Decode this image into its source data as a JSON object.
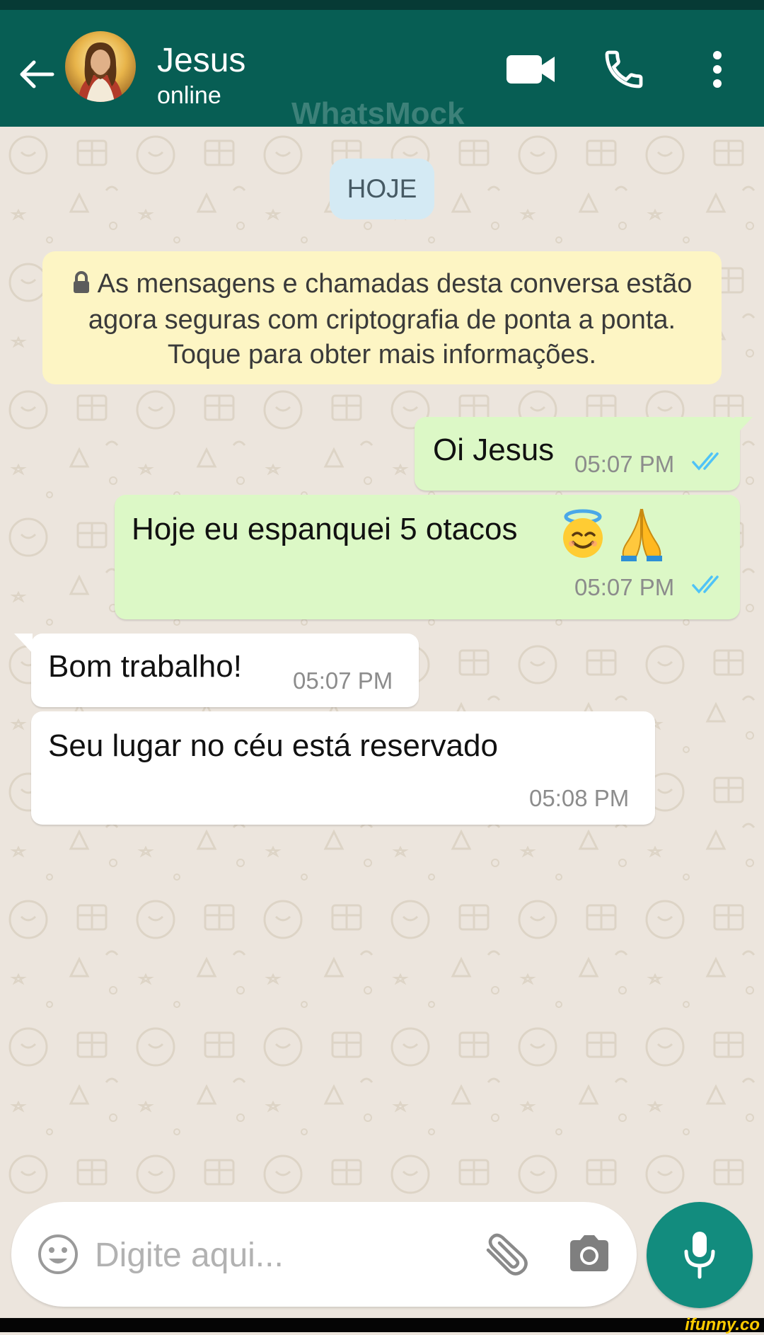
{
  "header": {
    "contact_name": "Jesus",
    "contact_status": "online",
    "watermark": "WhatsMock",
    "icons": [
      "back-arrow-icon",
      "video-call-icon",
      "phone-icon",
      "more-vertical-icon"
    ]
  },
  "chat": {
    "date_label": "HOJE",
    "encryption_notice": "As mensagens e chamadas desta conversa estão agora seguras com criptografia de ponta a ponta. Toque para obter mais informações.",
    "messages": [
      {
        "direction": "outgoing",
        "text": "Oi Jesus",
        "time": "05:07 PM",
        "status": "read"
      },
      {
        "direction": "outgoing",
        "text": "Hoje eu espanquei 5 otacos",
        "emoji": "😇🙏",
        "time": "05:07 PM",
        "status": "read"
      },
      {
        "direction": "incoming",
        "text": "Bom trabalho!",
        "time": "05:07 PM"
      },
      {
        "direction": "incoming",
        "text": "Seu lugar no céu está reservado",
        "time": "05:08 PM"
      }
    ]
  },
  "composer": {
    "placeholder": "Digite aqui...",
    "icons": [
      "emoji-icon",
      "attach-icon",
      "camera-icon",
      "mic-icon"
    ]
  },
  "watermark_footer": "ifunny.co",
  "colors": {
    "header": "#075e54",
    "outgoing_bubble": "#dcf8c6",
    "incoming_bubble": "#ffffff",
    "chat_background": "#ece5dd",
    "read_ticks": "#4fc3f7",
    "mic_button": "#128c7e"
  }
}
